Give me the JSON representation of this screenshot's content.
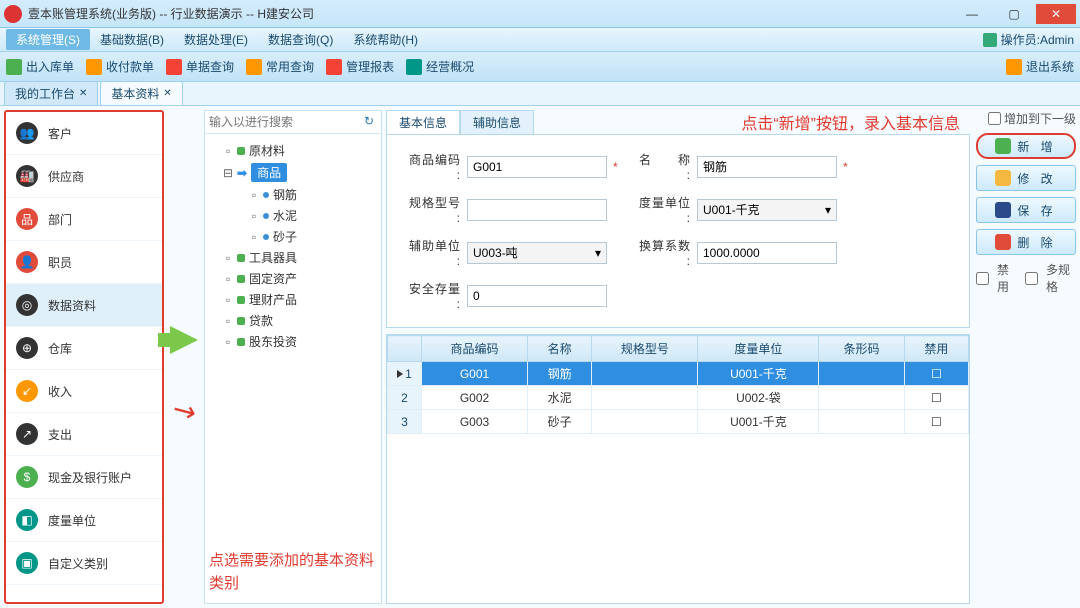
{
  "window": {
    "title": "壹本账管理系统(业务版) -- 行业数据演示 -- H建安公司",
    "min": "—",
    "max": "▢",
    "close": "✕"
  },
  "menu": {
    "items": [
      "系统管理(S)",
      "基础数据(B)",
      "数据处理(E)",
      "数据查询(Q)",
      "系统帮助(H)"
    ],
    "operator_label": "操作员:Admin"
  },
  "toolbar": {
    "items": [
      "出入库单",
      "收付款单",
      "单据查询",
      "常用查询",
      "管理报表",
      "经营概况"
    ],
    "exit": "退出系统"
  },
  "tabs": {
    "t1": "我的工作台",
    "t2": "基本资料"
  },
  "leftnav": {
    "items": [
      "客户",
      "供应商",
      "部门",
      "职员",
      "数据资料",
      "仓库",
      "收入",
      "支出",
      "现金及银行账户",
      "度量单位",
      "自定义类别"
    ]
  },
  "tree": {
    "search_placeholder": "输入以进行搜索",
    "n0": "原材料",
    "n1": "商品",
    "n1a": "钢筋",
    "n1b": "水泥",
    "n1c": "砂子",
    "n2": "工具器具",
    "n3": "固定资产",
    "n4": "理财产品",
    "n5": "贷款",
    "n6": "股东投资"
  },
  "annot": {
    "top": "点击“新增”按钮，录入基本信息",
    "left": "点选需要添加的基本资料类别"
  },
  "inner_tabs": {
    "a": "基本信息",
    "b": "辅助信息"
  },
  "form": {
    "code_lbl": "商品编码 :",
    "code_val": "G001",
    "name_lbl": "名　　称 :",
    "name_val": "钢筋",
    "spec_lbl": "规格型号 :",
    "spec_val": "",
    "uom_lbl": "度量单位 :",
    "uom_val": "U001-千克",
    "aux_lbl": "辅助单位 :",
    "aux_val": "U003-吨",
    "factor_lbl": "换算系数 :",
    "factor_val": "1000.0000",
    "safe_lbl": "安全存量 :",
    "safe_val": "0"
  },
  "grid": {
    "headers": [
      "",
      "商品编码",
      "名称",
      "规格型号",
      "度量单位",
      "条形码",
      "禁用"
    ],
    "rows": [
      {
        "n": "1",
        "code": "G001",
        "name": "钢筋",
        "spec": "",
        "uom": "U001-千克",
        "bar": "",
        "dis": "☐"
      },
      {
        "n": "2",
        "code": "G002",
        "name": "水泥",
        "spec": "",
        "uom": "U002-袋",
        "bar": "",
        "dis": "☐"
      },
      {
        "n": "3",
        "code": "G003",
        "name": "砂子",
        "spec": "",
        "uom": "U001-千克",
        "bar": "",
        "dis": "☐"
      }
    ]
  },
  "buttons": {
    "addchild": "增加到下一级",
    "add": "新 增",
    "edit": "修 改",
    "save": "保 存",
    "del": "删 除",
    "disable": "禁用",
    "multi": "多规格"
  }
}
